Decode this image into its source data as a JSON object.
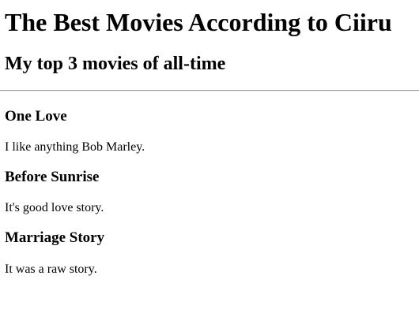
{
  "page": {
    "title": "The Best Movies According to Ciiru",
    "subtitle": "My top 3 movies of all-time"
  },
  "movies": [
    {
      "title": "One Love",
      "description": "I like anything Bob Marley."
    },
    {
      "title": "Before Sunrise",
      "description": "It's good love story."
    },
    {
      "title": "Marriage Story",
      "description": "It was a raw story."
    }
  ]
}
